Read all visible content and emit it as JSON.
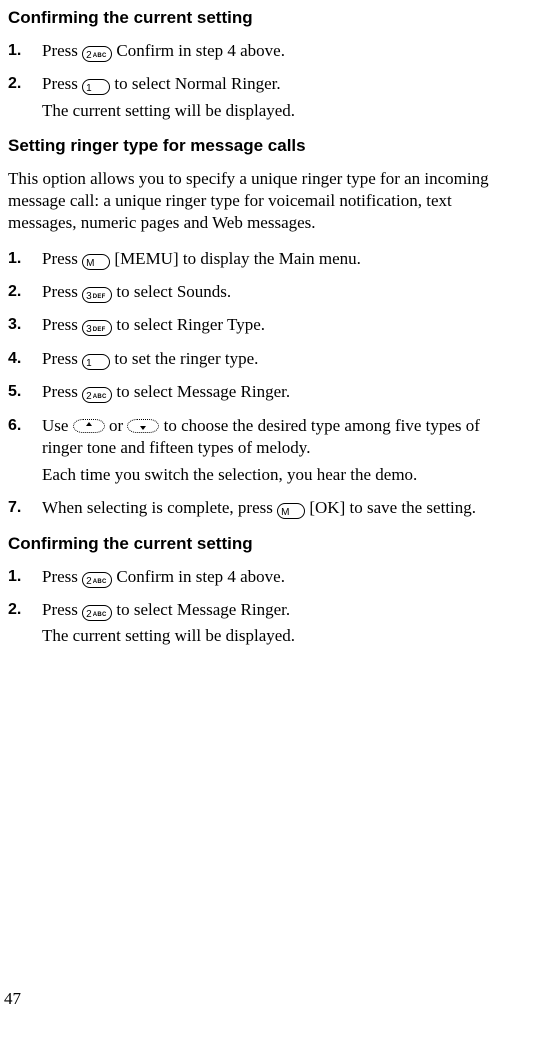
{
  "page_number": "47",
  "section_a": {
    "heading": "Confirming the current setting",
    "steps": [
      {
        "num": "1.",
        "pre": "Press ",
        "key_digit": "2",
        "key_letters": "ABC",
        "post": " Confirm in step 4 above."
      },
      {
        "num": "2.",
        "pre": "Press ",
        "key_digit": "1",
        "key_letters": "",
        "post": " to select Normal Ringer.",
        "cont": "The current setting will be displayed."
      }
    ]
  },
  "section_b": {
    "heading": "Setting ringer type for message calls",
    "intro": "This option allows you to specify a unique ringer type for an incoming message call: a unique ringer type for voicemail notification, text messages, numeric pages and Web messages.",
    "steps": [
      {
        "num": "1.",
        "pre": "Press ",
        "key_digit": "M",
        "key_letters": "",
        "post": " [MEMU] to display the Main menu."
      },
      {
        "num": "2.",
        "pre": "Press ",
        "key_digit": "3",
        "key_letters": "DEF",
        "post": " to select Sounds."
      },
      {
        "num": "3.",
        "pre": "Press ",
        "key_digit": "3",
        "key_letters": "DEF",
        "post": " to select Ringer Type."
      },
      {
        "num": "4.",
        "pre": "Press ",
        "key_digit": "1",
        "key_letters": "",
        "post": " to set the ringer type."
      },
      {
        "num": "5.",
        "pre": "Press ",
        "key_digit": "2",
        "key_letters": "ABC",
        "post": " to select Message Ringer."
      },
      {
        "num": "6.",
        "pre": "Use ",
        "mid": " or ",
        "post": " to choose the desired type among five types of ringer tone and fifteen types of melody.",
        "cont": "Each time you switch the selection, you hear the demo."
      },
      {
        "num": "7.",
        "pre": "When selecting is complete, press ",
        "key_digit": "M",
        "key_letters": "",
        "post": " [OK] to save the setting."
      }
    ]
  },
  "section_c": {
    "heading": "Confirming the current setting",
    "steps": [
      {
        "num": "1.",
        "pre": "Press ",
        "key_digit": "2",
        "key_letters": "ABC",
        "post": " Confirm in step 4 above."
      },
      {
        "num": "2.",
        "pre": "Press ",
        "key_digit": "2",
        "key_letters": "ABC",
        "post": " to select Message Ringer.",
        "cont": "The current setting will be displayed."
      }
    ]
  }
}
